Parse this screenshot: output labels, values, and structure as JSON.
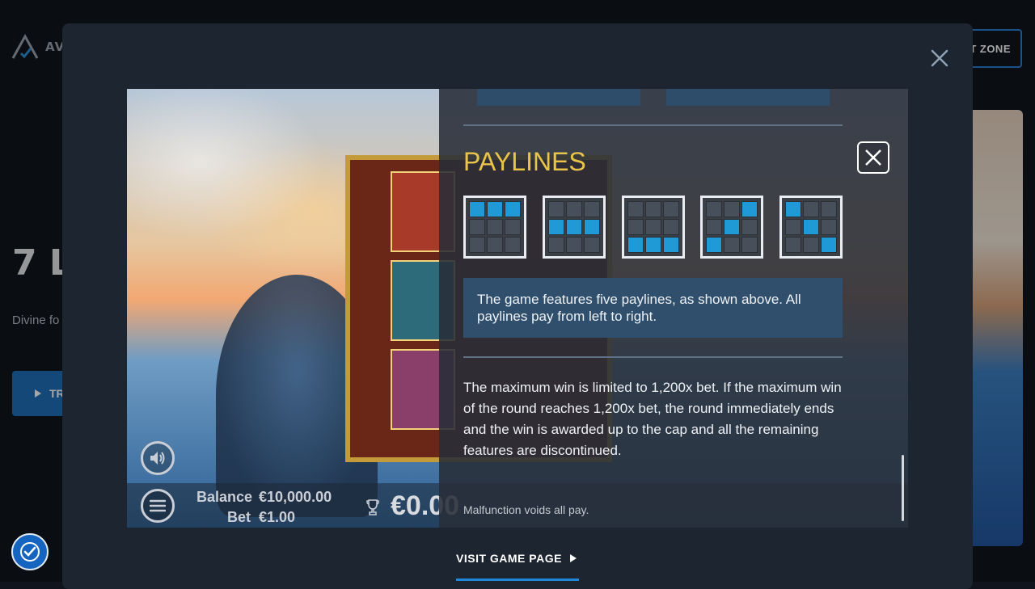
{
  "site": {
    "logo_text": "AVA",
    "cta_label": "T ZONE",
    "game_title": "7 L",
    "game_subtitle": "Divine fo",
    "play_button_label": "TR"
  },
  "modal": {
    "visit_link_label": "VISIT GAME PAGE"
  },
  "game": {
    "balance_label": "Balance",
    "balance_value": "€10,000.00",
    "bet_label": "Bet",
    "bet_value": "€1.00",
    "win_value": "€0.00"
  },
  "paytable": {
    "heading": "PAYLINES",
    "paylines": [
      [
        1,
        1,
        1,
        0,
        0,
        0,
        0,
        0,
        0
      ],
      [
        0,
        0,
        0,
        1,
        1,
        1,
        0,
        0,
        0
      ],
      [
        0,
        0,
        0,
        0,
        0,
        0,
        1,
        1,
        1
      ],
      [
        0,
        0,
        1,
        0,
        1,
        0,
        1,
        0,
        0
      ],
      [
        1,
        0,
        0,
        0,
        1,
        0,
        0,
        0,
        1
      ]
    ],
    "info_text": "The game features five paylines, as shown above. All paylines pay from left to right.",
    "max_win_text": "The maximum win is limited to 1,200x bet. If the maximum win of the round reaches 1,200x bet, the round immediately ends and the win is awarded up to the cap and all the remaining features are discontinued.",
    "footer_text": "Malfunction voids all pay."
  },
  "colors": {
    "heading": "#e8c44a",
    "payline_active": "#1f9ad6",
    "link_underline": "#1f88d9"
  }
}
